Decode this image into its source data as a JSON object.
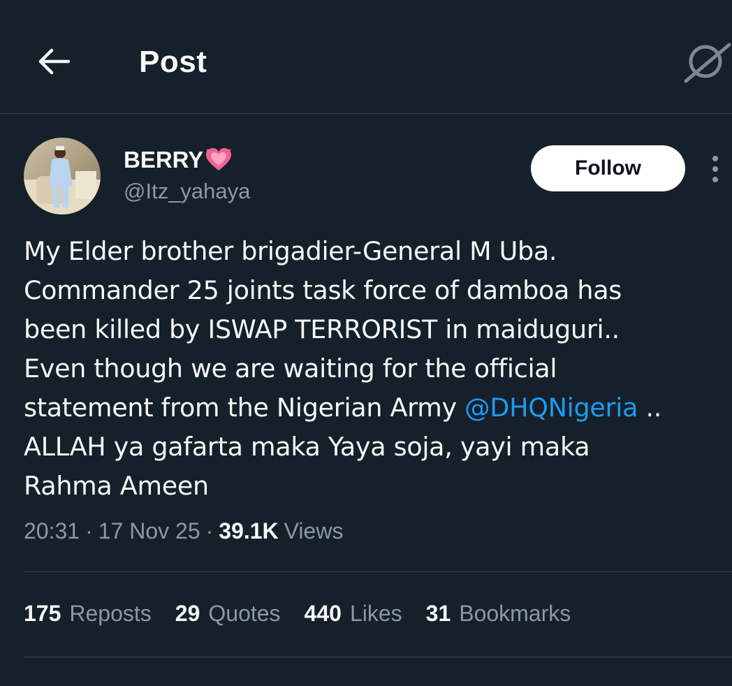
{
  "header": {
    "title": "Post",
    "back_icon": "arrow-left-icon",
    "grok_icon": "grok-icon"
  },
  "author": {
    "display_name": "BERRY",
    "emoji": "sparkling-heart",
    "handle": "@Itz_yahaya",
    "follow_label": "Follow"
  },
  "tweet": {
    "text_before_mention": "My Elder brother brigadier-General M Uba.\nCommander 25 joints task force of damboa has\nbeen killed by ISWAP TERRORIST in maiduguri..\nEven though we are waiting for the official\nstatement from the Nigerian Army ",
    "mention": "@DHQNigeria",
    "text_after_mention": " ..\nALLAH ya gafarta maka Yaya soja, yayi maka\nRahma Ameen"
  },
  "meta": {
    "time": "20:31",
    "separator": "·",
    "date": "17 Nov 25",
    "views_count": "39.1K",
    "views_label": "Views"
  },
  "stats": [
    {
      "count": "175",
      "label": "Reposts"
    },
    {
      "count": "29",
      "label": "Quotes"
    },
    {
      "count": "440",
      "label": "Likes"
    },
    {
      "count": "31",
      "label": "Bookmarks"
    }
  ],
  "colors": {
    "background": "#15202b",
    "text": "#f7f9f9",
    "secondary": "#8b98a5",
    "accent": "#1d9bf0",
    "border": "#38444d",
    "heart": "#f06292"
  }
}
